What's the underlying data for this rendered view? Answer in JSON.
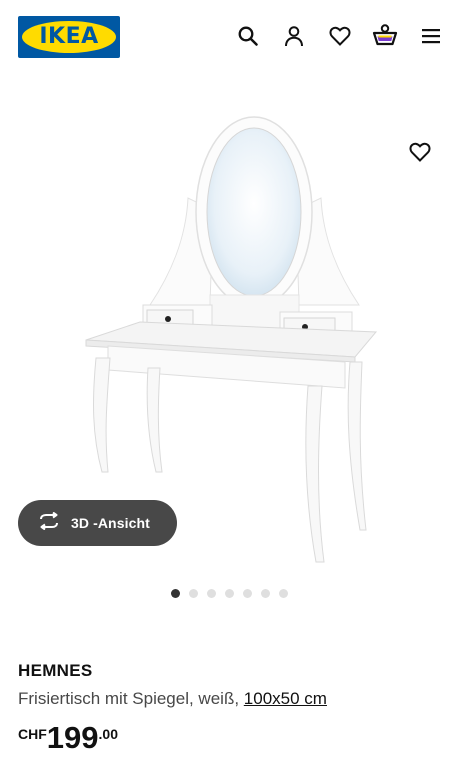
{
  "header": {
    "logo_text": "IKEA",
    "icons": [
      "search-icon",
      "account-icon",
      "heart-icon",
      "basket-icon",
      "menu-icon"
    ],
    "basket_count": "0",
    "colors": {
      "logo_blue": "#0058a3",
      "logo_yellow": "#ffdb00"
    }
  },
  "gallery": {
    "image_subject": "vanity-table-with-mirror",
    "view3d_label": "3D -Ansicht",
    "slides_total": 7,
    "active_slide": 1,
    "favourite_icon": "heart-outline-icon"
  },
  "product": {
    "name": "HEMNES",
    "description": "Frisiertisch mit Spiegel, weiß,",
    "dimensions": "100x50 cm",
    "currency": "CHF",
    "price_integer": "199",
    "price_decimals": ".00"
  }
}
